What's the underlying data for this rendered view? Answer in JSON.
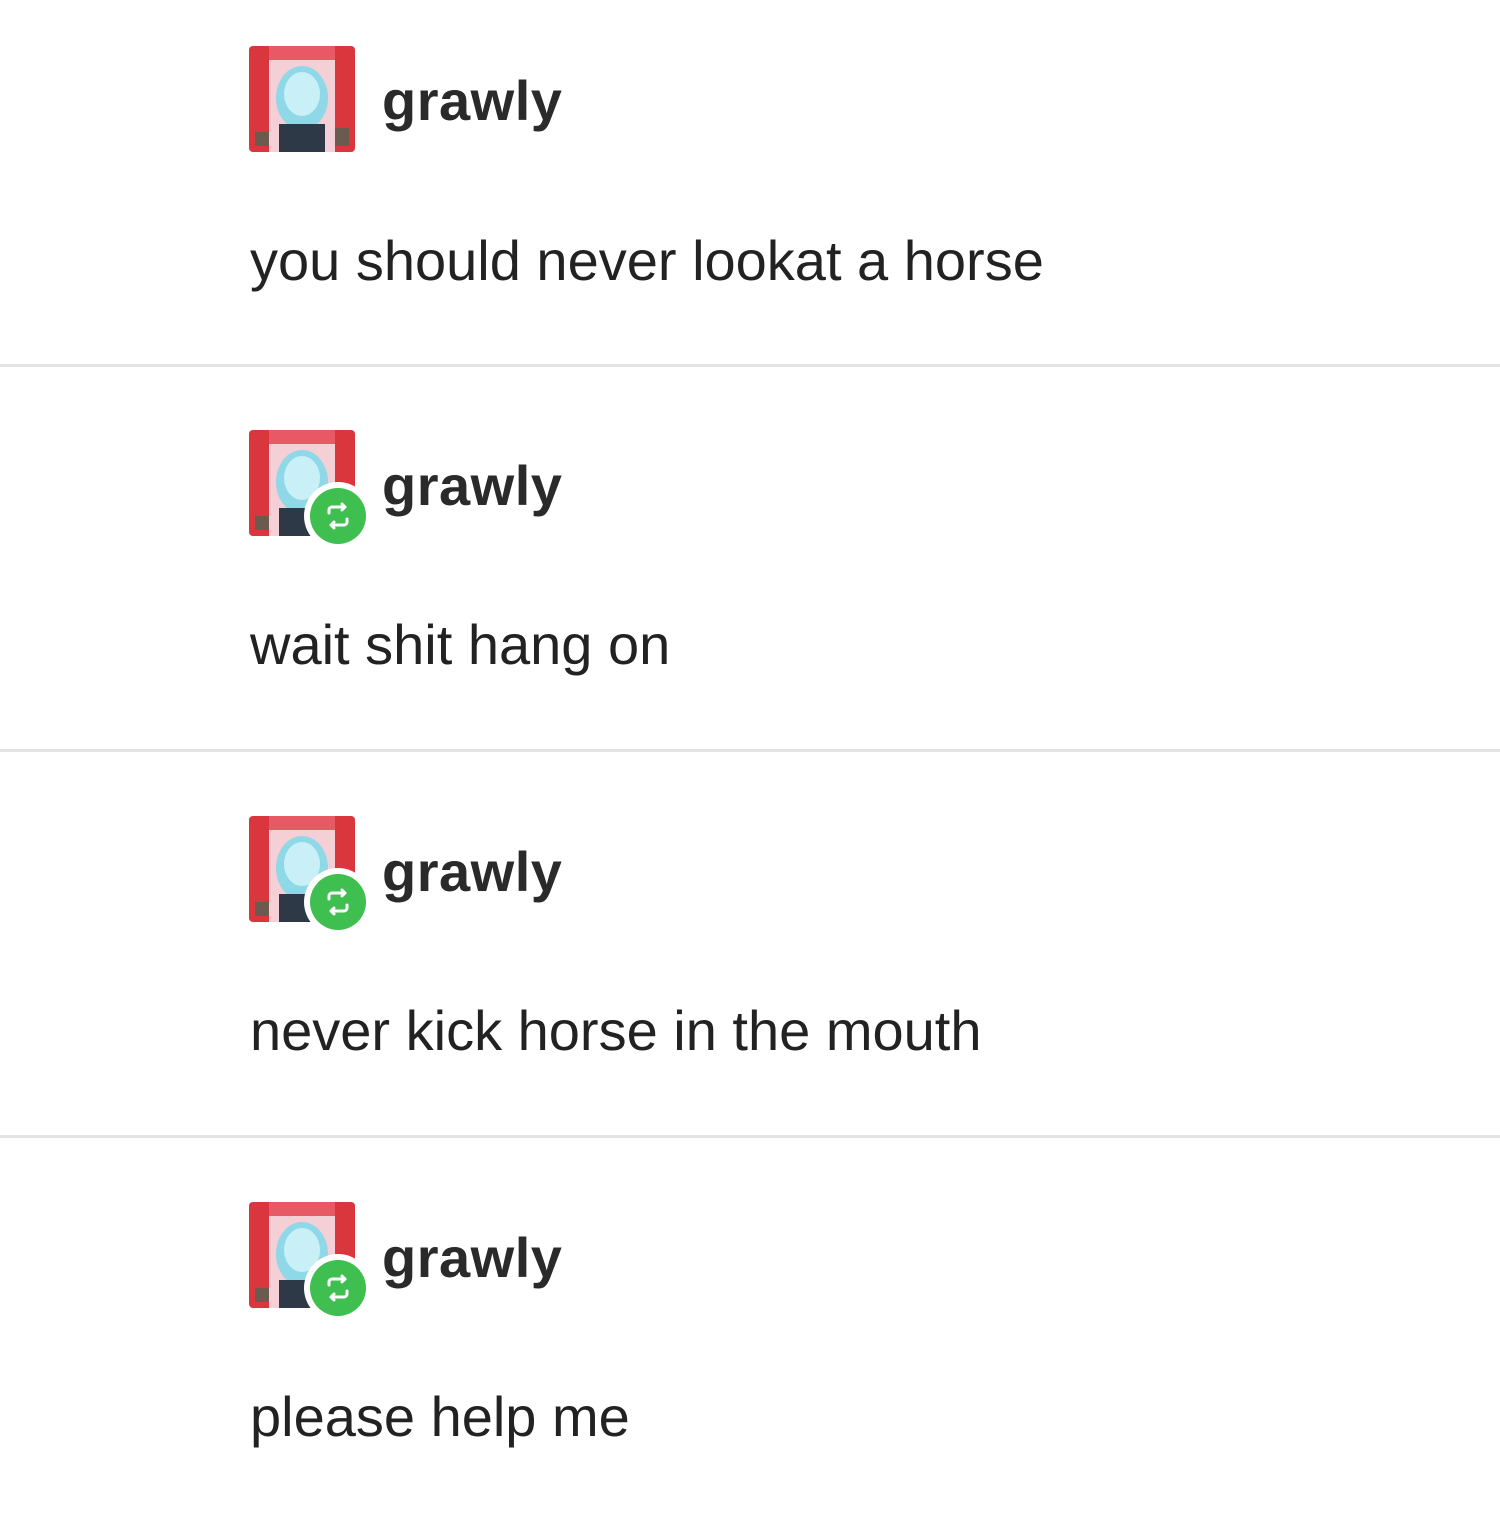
{
  "colors": {
    "background": "#ffffff",
    "text": "#222222",
    "divider": "#e3e3e3",
    "reblog_badge": "#3fbf4f",
    "avatar_background": "#f6d6dc"
  },
  "posts": [
    {
      "username": "grawly",
      "avatar_icon": "avatar-image",
      "reblog_icon": null,
      "text": "you should never lookat a horse"
    },
    {
      "username": "grawly",
      "avatar_icon": "avatar-image",
      "reblog_icon": "reblog-icon",
      "text": "wait shit hang on"
    },
    {
      "username": "grawly",
      "avatar_icon": "avatar-image",
      "reblog_icon": "reblog-icon",
      "text": "never kick horse in the mouth"
    },
    {
      "username": "grawly",
      "avatar_icon": "avatar-image",
      "reblog_icon": "reblog-icon",
      "text": "please help me"
    }
  ]
}
